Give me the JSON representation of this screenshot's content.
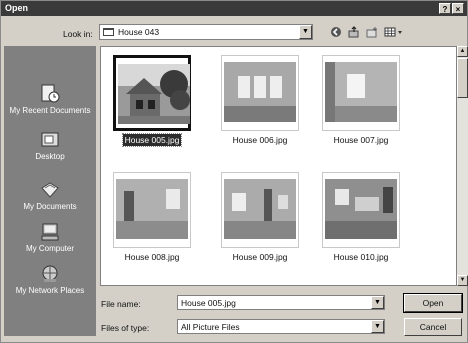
{
  "window": {
    "title": "Open",
    "help_label": "?",
    "close_label": "×"
  },
  "toolbar": {
    "look_in_label": "Look in:",
    "look_in_value": "House 043",
    "dropdown_glyph": "▼",
    "back_icon": "back-arrow-icon",
    "up_icon": "up-folder-icon",
    "new_folder_icon": "new-folder-icon",
    "views_icon": "views-menu-icon"
  },
  "places": [
    {
      "label": "My Recent Documents",
      "icon": "recent-documents-icon"
    },
    {
      "label": "Desktop",
      "icon": "desktop-icon"
    },
    {
      "label": "My Documents",
      "icon": "my-documents-icon"
    },
    {
      "label": "My Computer",
      "icon": "my-computer-icon"
    },
    {
      "label": "My Network Places",
      "icon": "network-places-icon"
    }
  ],
  "files": [
    {
      "name": "House 005.jpg",
      "selected": true
    },
    {
      "name": "House 006.jpg",
      "selected": false
    },
    {
      "name": "House 007.jpg",
      "selected": false
    },
    {
      "name": "House 008.jpg",
      "selected": false
    },
    {
      "name": "House 009.jpg",
      "selected": false
    },
    {
      "name": "House 010.jpg",
      "selected": false
    }
  ],
  "form": {
    "file_name_label": "File name:",
    "file_name_value": "House 005.jpg",
    "file_type_label": "Files of type:",
    "file_type_value": "All Picture Files"
  },
  "actions": {
    "open_label": "Open",
    "cancel_label": "Cancel"
  }
}
